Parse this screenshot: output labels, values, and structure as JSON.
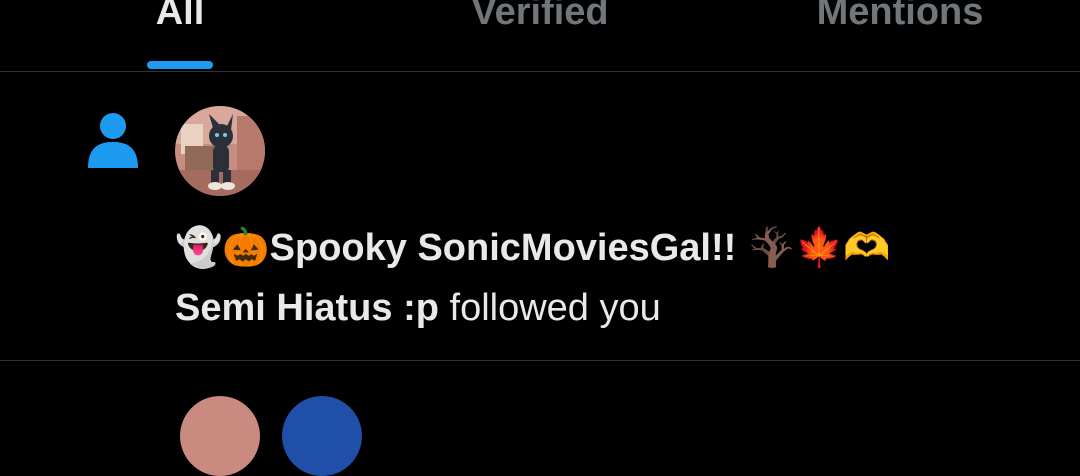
{
  "tabs": [
    {
      "label": "All",
      "active": true
    },
    {
      "label": "Verified",
      "active": false
    },
    {
      "label": "Mentions",
      "active": false
    }
  ],
  "colors": {
    "accent": "#1d9bf0",
    "background": "#000000",
    "text_primary": "#e7e9ea",
    "text_secondary": "#71767b",
    "divider": "#2f3336"
  },
  "notification": {
    "icon": "person-icon",
    "avatar": "user-avatar",
    "user_display_name_prefix": "👻🎃",
    "user_display_name": "Spooky SonicMoviesGal!!",
    "user_display_name_suffix": " 🪾🍁🫶",
    "user_display_name_line2": "Semi Hiatus :p",
    "action_text": " followed you"
  }
}
